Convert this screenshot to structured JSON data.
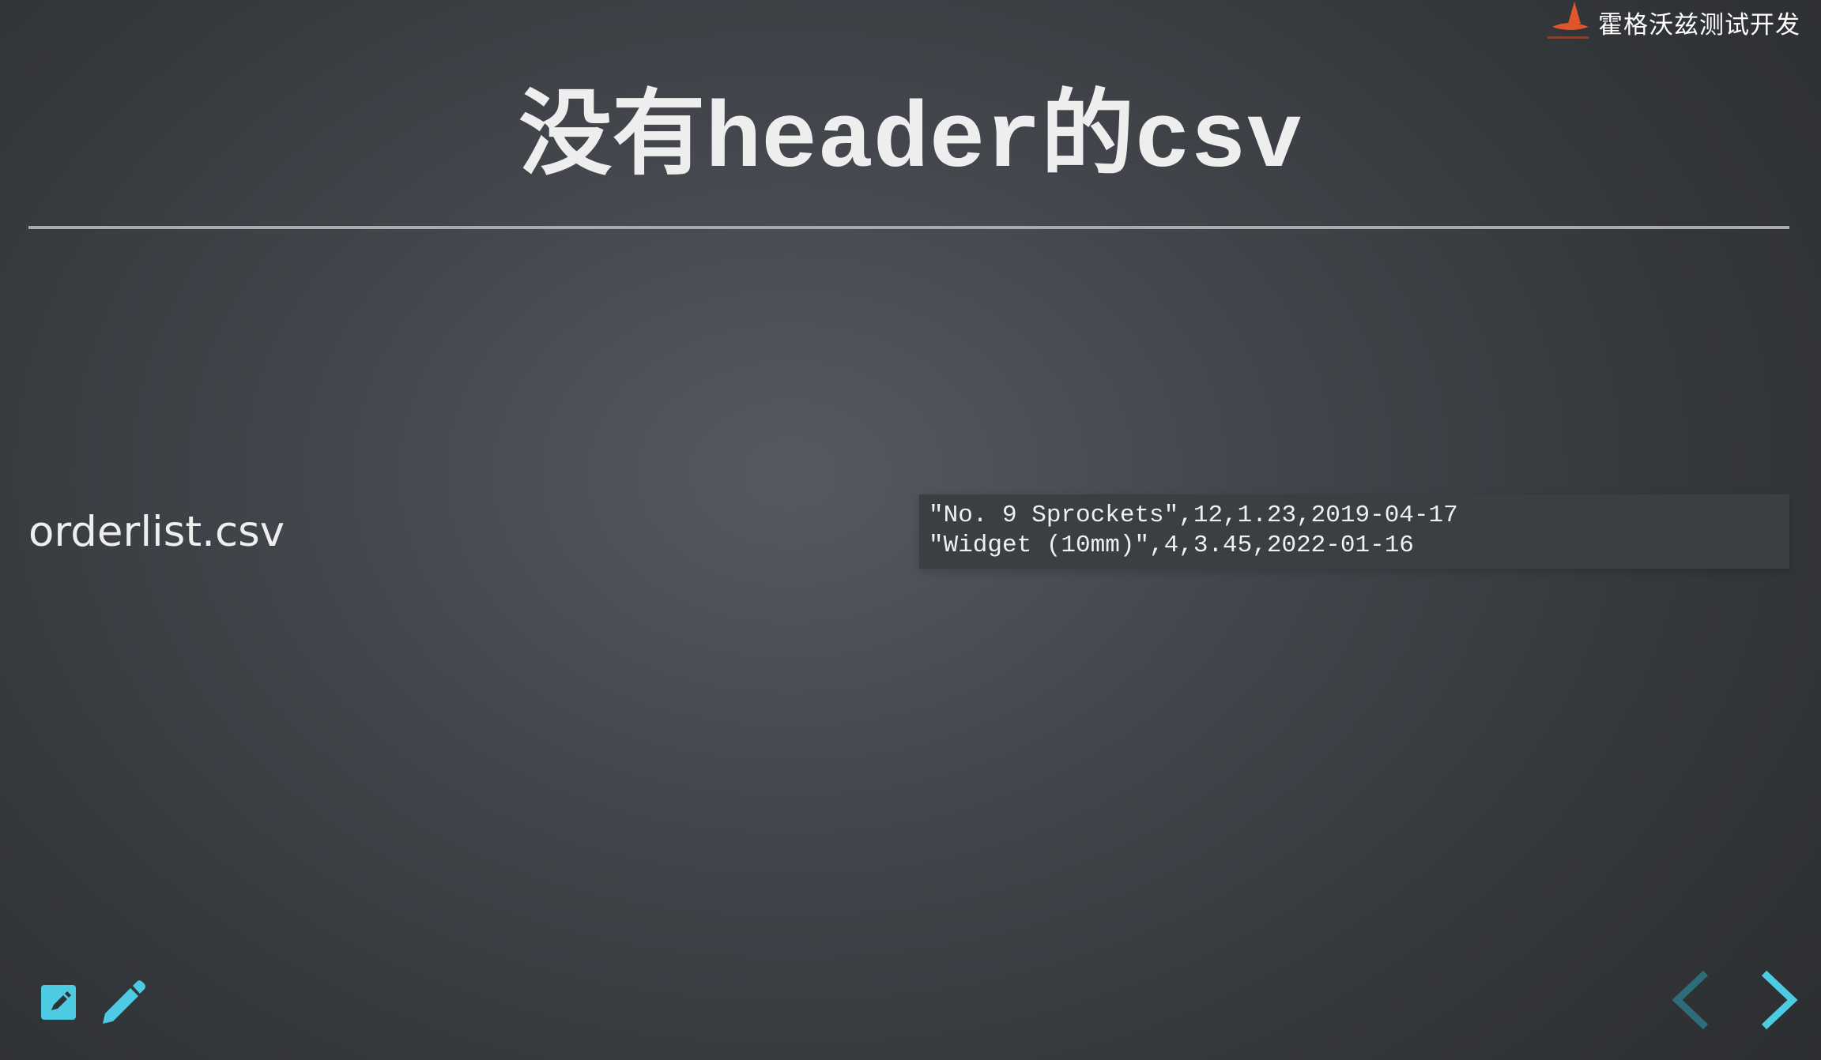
{
  "header": {
    "brand_name": "霍格沃兹测试开发",
    "logo_icon": "witch-hat-logo-icon"
  },
  "slide": {
    "title": "没有header的csv",
    "left_text": "orderlist.csv",
    "code_lines": [
      "\"No. 9 Sprockets\",12,1.23,2019-04-17",
      "\"Widget (10mm)\",4,3.45,2022-01-16"
    ]
  },
  "controls": {
    "editor_icon": "edit-box-icon",
    "pen_icon": "pencil-icon",
    "prev_icon": "chevron-left-icon",
    "next_icon": "chevron-right-icon"
  },
  "colors": {
    "accent": "#4ccbe3",
    "accent_disabled": "#2d6c78",
    "logo": "#e0562a",
    "text": "#eeeeee"
  }
}
